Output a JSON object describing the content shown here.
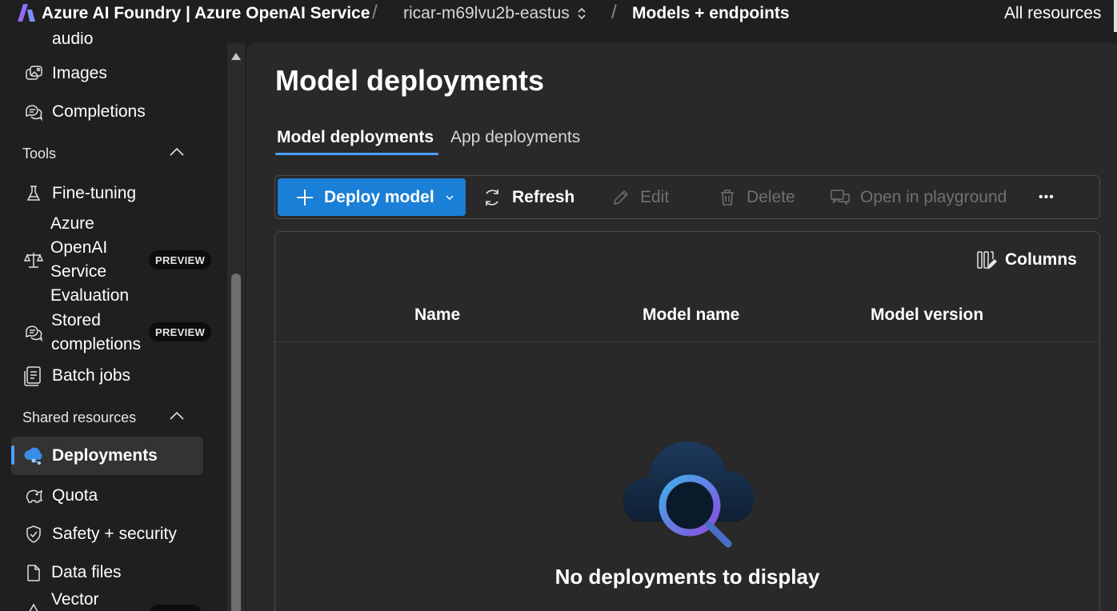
{
  "topbar": {
    "brand_title": "Azure AI Foundry | Azure OpenAI Service",
    "resource_name": "ricar-m69lvu2b-eastus",
    "current_page": "Models + endpoints",
    "all_resources_label": "All resources",
    "separator": "/"
  },
  "sidebar": {
    "partial_item": {
      "label": "audio",
      "icon": "audio-icon"
    },
    "items_top": [
      {
        "label": "Images",
        "icon": "image-icon"
      },
      {
        "label": "Completions",
        "icon": "chat-icon"
      }
    ],
    "tools_section": {
      "title": "Tools",
      "items": [
        {
          "label": "Fine-tuning",
          "icon": "flask-icon"
        },
        {
          "label": "Azure OpenAI Service Evaluation",
          "lines": [
            "Azure",
            "OpenAI",
            "Service",
            "Evaluation"
          ],
          "icon": "scale-icon",
          "badge": "PREVIEW"
        },
        {
          "label": "Stored completions",
          "lines": [
            "Stored",
            "completions"
          ],
          "icon": "chat-icon",
          "badge": "PREVIEW"
        },
        {
          "label": "Batch jobs",
          "icon": "batch-icon"
        }
      ]
    },
    "shared_section": {
      "title": "Shared resources",
      "items": [
        {
          "label": "Deployments",
          "icon": "cloud-deploy-icon",
          "active": true
        },
        {
          "label": "Quota",
          "icon": "piggy-bank-icon"
        },
        {
          "label": "Safety + security",
          "icon": "shield-icon"
        },
        {
          "label": "Data files",
          "icon": "document-icon"
        },
        {
          "label": "Vector",
          "icon": "vector-store-icon"
        }
      ]
    }
  },
  "main": {
    "page_title": "Model deployments",
    "tabs": [
      {
        "label": "Model deployments",
        "active": true
      },
      {
        "label": "App deployments",
        "active": false
      }
    ],
    "toolbar": {
      "deploy_label": "Deploy model",
      "refresh_label": "Refresh",
      "edit_label": "Edit",
      "delete_label": "Delete",
      "playground_label": "Open in playground",
      "more_label": "•••"
    },
    "grid": {
      "columns_button": "Columns",
      "headers": [
        "Name",
        "Model name",
        "Model version"
      ],
      "empty_message": "No deployments to display"
    }
  },
  "colors": {
    "accent": "#1a7fd6",
    "active_indicator": "#4aa0f5",
    "background": "#1f1f1f",
    "panel": "#292929",
    "disabled_text": "#707070"
  }
}
